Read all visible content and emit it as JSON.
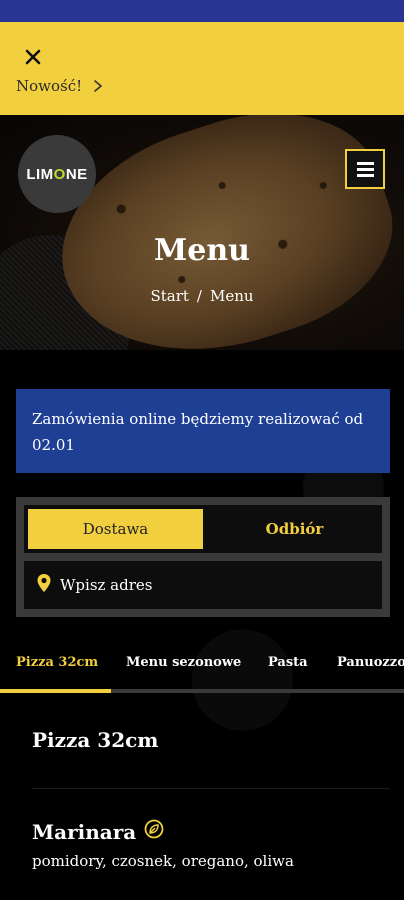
{
  "promo": {
    "text": "Nowość!",
    "close_icon": "close-icon",
    "chevron_icon": "chevron-right-icon"
  },
  "header": {
    "logo_text_prefix": "LIM",
    "logo_text_o": "O",
    "logo_text_suffix": "NE",
    "menu_icon": "hamburger-menu-icon",
    "title": "Menu",
    "breadcrumb": {
      "start": "Start",
      "separator": "/",
      "current": "Menu"
    }
  },
  "notice": {
    "text": "Zamówienia online będziemy realizować od 02.01"
  },
  "order": {
    "delivery_label": "Dostawa",
    "pickup_label": "Odbiór",
    "address_placeholder": "Wpisz adres",
    "pin_icon": "location-pin-icon"
  },
  "categories": {
    "tabs": [
      "Pizza 32cm",
      "Menu sezonowe",
      "Pasta",
      "Panuozzo"
    ],
    "active_index": 0
  },
  "menu": {
    "section_title": "Pizza 32cm",
    "items": [
      {
        "name": "Marinara",
        "badge_icon": "vegan-leaf-icon",
        "description": "pomidory, czosnek, oregano, oliwa"
      }
    ]
  },
  "colors": {
    "accent": "#f2cf3e",
    "notice_bg": "#1f3f95",
    "status_bar": "#283593",
    "logo_o": "#c4d92e"
  }
}
